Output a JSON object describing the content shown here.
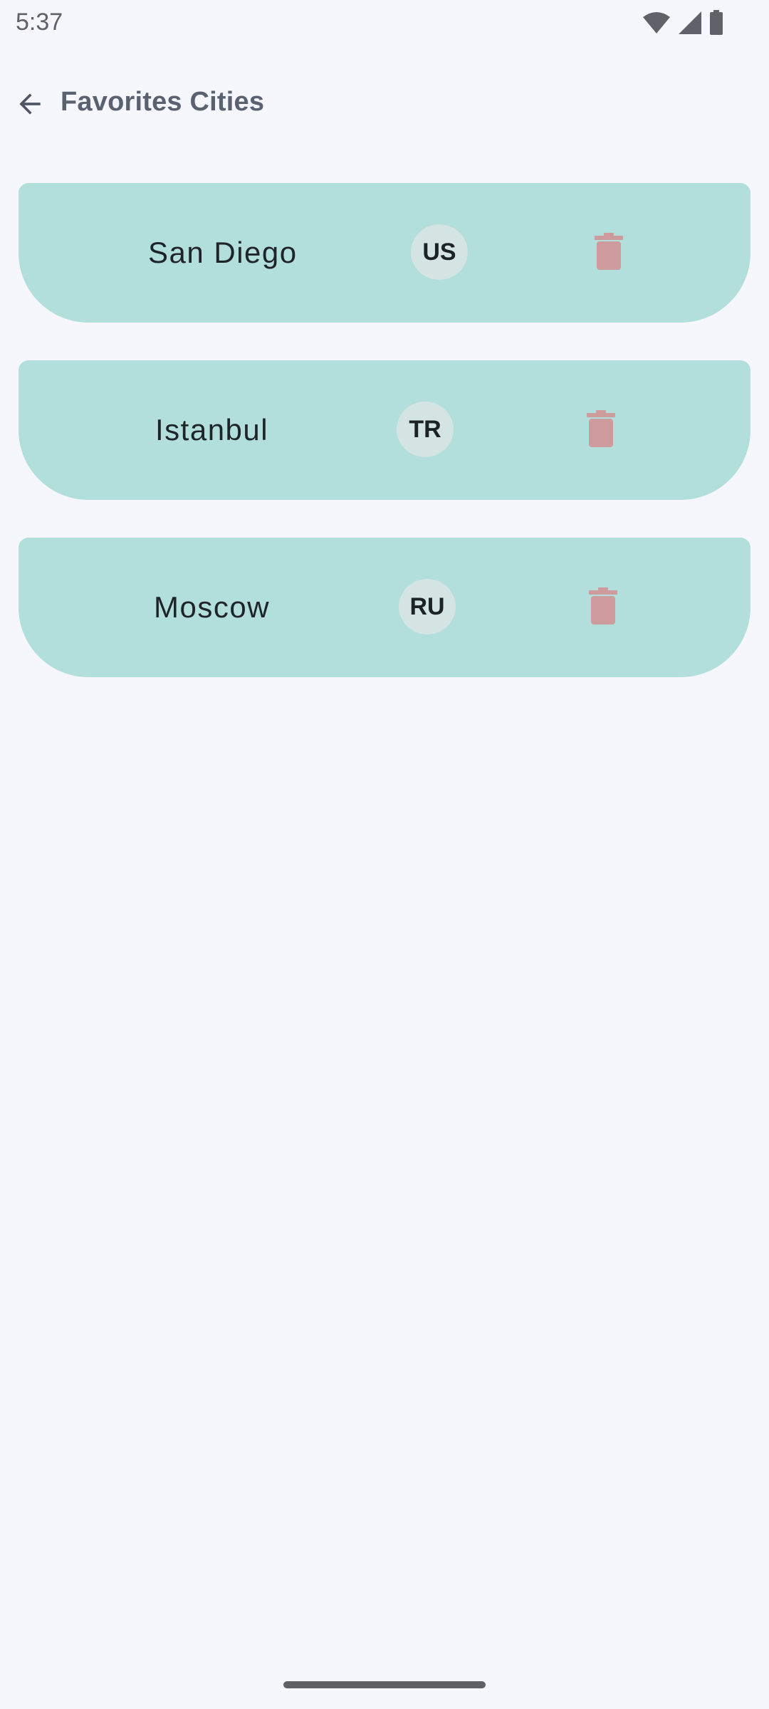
{
  "status_bar": {
    "time": "5:37",
    "icons": [
      "wifi-icon",
      "signal-icon",
      "battery-icon"
    ]
  },
  "app_bar": {
    "back_icon": "arrow-back-icon",
    "title": "Favorites Cities"
  },
  "cities": [
    {
      "name": "San Diego",
      "country": "US",
      "delete_icon": "trash-icon"
    },
    {
      "name": "Istanbul",
      "country": "TR",
      "delete_icon": "trash-icon"
    },
    {
      "name": "Moscow",
      "country": "RU",
      "delete_icon": "trash-icon"
    }
  ],
  "colors": {
    "background": "#f6f7fd",
    "card": "#b2dfdb",
    "chip": "#d3e4e2",
    "delete_icon": "#cd9b9b",
    "title": "#5a6272"
  }
}
